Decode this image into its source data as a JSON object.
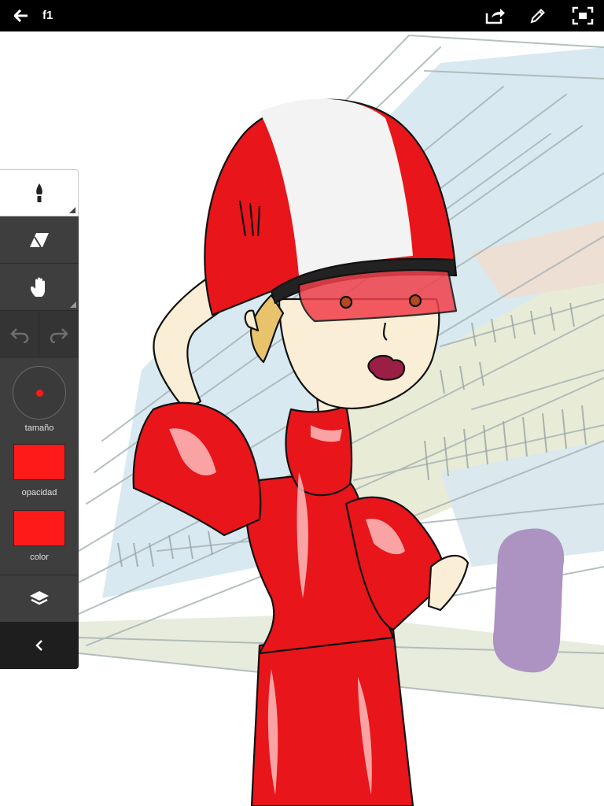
{
  "topbar": {
    "title": "f1",
    "back_icon": "arrow-left-icon",
    "share_icon": "share-icon",
    "edit_icon": "pencil-icon",
    "fullscreen_icon": "fullscreen-icon"
  },
  "tools": {
    "brush_icon": "brush-icon",
    "eraser_icon": "eraser-icon",
    "hand_icon": "hand-icon",
    "undo_icon": "undo-icon",
    "redo_icon": "redo-icon",
    "layers_icon": "layers-icon",
    "collapse_icon": "chevron-left-icon"
  },
  "props": {
    "size_label": "tamaño",
    "opacity_label": "opacidad",
    "color_label": "color",
    "current_color": "#ff1a1a"
  },
  "colors": {
    "topbar": "#000000",
    "panel": "#3e3e3e",
    "dress_red": "#e8151a",
    "purple_stroke": "#ac93c2"
  }
}
